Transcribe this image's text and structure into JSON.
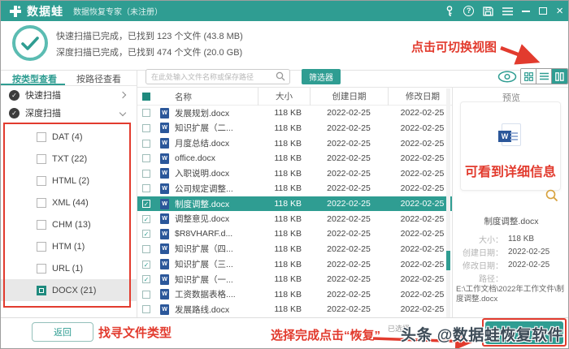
{
  "titlebar": {
    "app_name": "数据蛙",
    "subtitle": "数据恢复专家（未注册）",
    "window_icons": [
      "key-icon",
      "help-icon",
      "save-icon",
      "menu-icon",
      "minimize-icon",
      "maximize-icon",
      "close-icon"
    ]
  },
  "status": {
    "line1": "快速扫描已完成，已找到 123 个文件 (43.8 MB)",
    "line2": "深度扫描已完成，已找到 474 个文件 (20.0 GB)"
  },
  "toolbar": {
    "search_placeholder": "在此处输入文件名称或保存路径",
    "filter_label": "筛选器",
    "view_icons": [
      "eye-icon",
      "grid-view-icon",
      "list-view-icon",
      "detail-view-icon"
    ],
    "active_view": "detail-view"
  },
  "sidebar": {
    "tabs": [
      {
        "label": "按类型查看",
        "active": true
      },
      {
        "label": "按路径查看",
        "active": false
      }
    ],
    "scans": [
      {
        "label": "快速扫描",
        "expanded": false
      },
      {
        "label": "深度扫描",
        "expanded": true
      }
    ],
    "types": [
      {
        "label": "DAT (4)",
        "checked": false,
        "selected": false
      },
      {
        "label": "TXT (22)",
        "checked": false,
        "selected": false
      },
      {
        "label": "HTML (2)",
        "checked": false,
        "selected": false
      },
      {
        "label": "XML (44)",
        "checked": false,
        "selected": false
      },
      {
        "label": "CHM (13)",
        "checked": false,
        "selected": false
      },
      {
        "label": "HTM (1)",
        "checked": false,
        "selected": false
      },
      {
        "label": "URL (1)",
        "checked": false,
        "selected": false
      },
      {
        "label": "DOCX (21)",
        "checked": true,
        "selected": true
      }
    ],
    "back_label": "返回"
  },
  "table": {
    "headers": [
      "名称",
      "大小",
      "创建日期",
      "修改日期"
    ],
    "rows": [
      {
        "name": "发展规划.docx",
        "size": "118 KB",
        "created": "2022-02-25",
        "modified": "2022-02-25",
        "checked": false,
        "selected": false
      },
      {
        "name": "知识扩展（二...",
        "size": "118 KB",
        "created": "2022-02-25",
        "modified": "2022-02-25",
        "checked": false,
        "selected": false
      },
      {
        "name": "月度总结.docx",
        "size": "118 KB",
        "created": "2022-02-25",
        "modified": "2022-02-25",
        "checked": false,
        "selected": false
      },
      {
        "name": "office.docx",
        "size": "118 KB",
        "created": "2022-02-25",
        "modified": "2022-02-25",
        "checked": false,
        "selected": false
      },
      {
        "name": "入职说明.docx",
        "size": "118 KB",
        "created": "2022-02-25",
        "modified": "2022-02-25",
        "checked": false,
        "selected": false
      },
      {
        "name": "公司规定调整...",
        "size": "118 KB",
        "created": "2022-02-25",
        "modified": "2022-02-25",
        "checked": false,
        "selected": false
      },
      {
        "name": "制度调整.docx",
        "size": "118 KB",
        "created": "2022-02-25",
        "modified": "2022-02-25",
        "checked": true,
        "selected": true
      },
      {
        "name": "调整意见.docx",
        "size": "118 KB",
        "created": "2022-02-25",
        "modified": "2022-02-25",
        "checked": true,
        "selected": false
      },
      {
        "name": "$R8VHARF.d...",
        "size": "118 KB",
        "created": "2022-02-25",
        "modified": "2022-02-25",
        "checked": true,
        "selected": false
      },
      {
        "name": "知识扩展（四...",
        "size": "118 KB",
        "created": "2022-02-25",
        "modified": "2022-02-25",
        "checked": false,
        "selected": false
      },
      {
        "name": "知识扩展（三...",
        "size": "118 KB",
        "created": "2022-02-25",
        "modified": "2022-02-25",
        "checked": true,
        "selected": false
      },
      {
        "name": "知识扩展（一...",
        "size": "118 KB",
        "created": "2022-02-25",
        "modified": "2022-02-25",
        "checked": true,
        "selected": false
      },
      {
        "name": "工资数据表格....",
        "size": "118 KB",
        "created": "2022-02-25",
        "modified": "2022-02-25",
        "checked": false,
        "selected": false
      },
      {
        "name": "发展路线.docx",
        "size": "118 KB",
        "created": "2022-02-25",
        "modified": "2022-02-25",
        "checked": false,
        "selected": false
      }
    ]
  },
  "preview": {
    "title": "预览",
    "filename": "制度调整.docx",
    "details": [
      {
        "label": "大小：",
        "value": "118 KB"
      },
      {
        "label": "创建日期：",
        "value": "2022-02-25"
      },
      {
        "label": "修改日期：",
        "value": "2022-02-25"
      },
      {
        "label": "路径：",
        "value": ""
      }
    ],
    "path": "E:\\工作文档\\2022年工作文件\\制度调整.docx"
  },
  "footer": {
    "selected_label": "已选择",
    "watermark": "头条 @数据蛙恢复软件"
  },
  "annotations": {
    "view_toggle": "点击可切换视图",
    "detail_info": "可看到详细信息",
    "find_type": "找寻文件类型",
    "recover_hint": "选择完成点击“恢复”"
  },
  "icons": {
    "word_glyph": "W",
    "check_glyph": "✓"
  },
  "colors": {
    "accent_teal": "#2f9d92",
    "dark_teal": "#1f8a7e",
    "annotation_red": "#e23b2e",
    "word_icon_blue": "#2b579a",
    "watermark_gray": "#3d4b57"
  }
}
